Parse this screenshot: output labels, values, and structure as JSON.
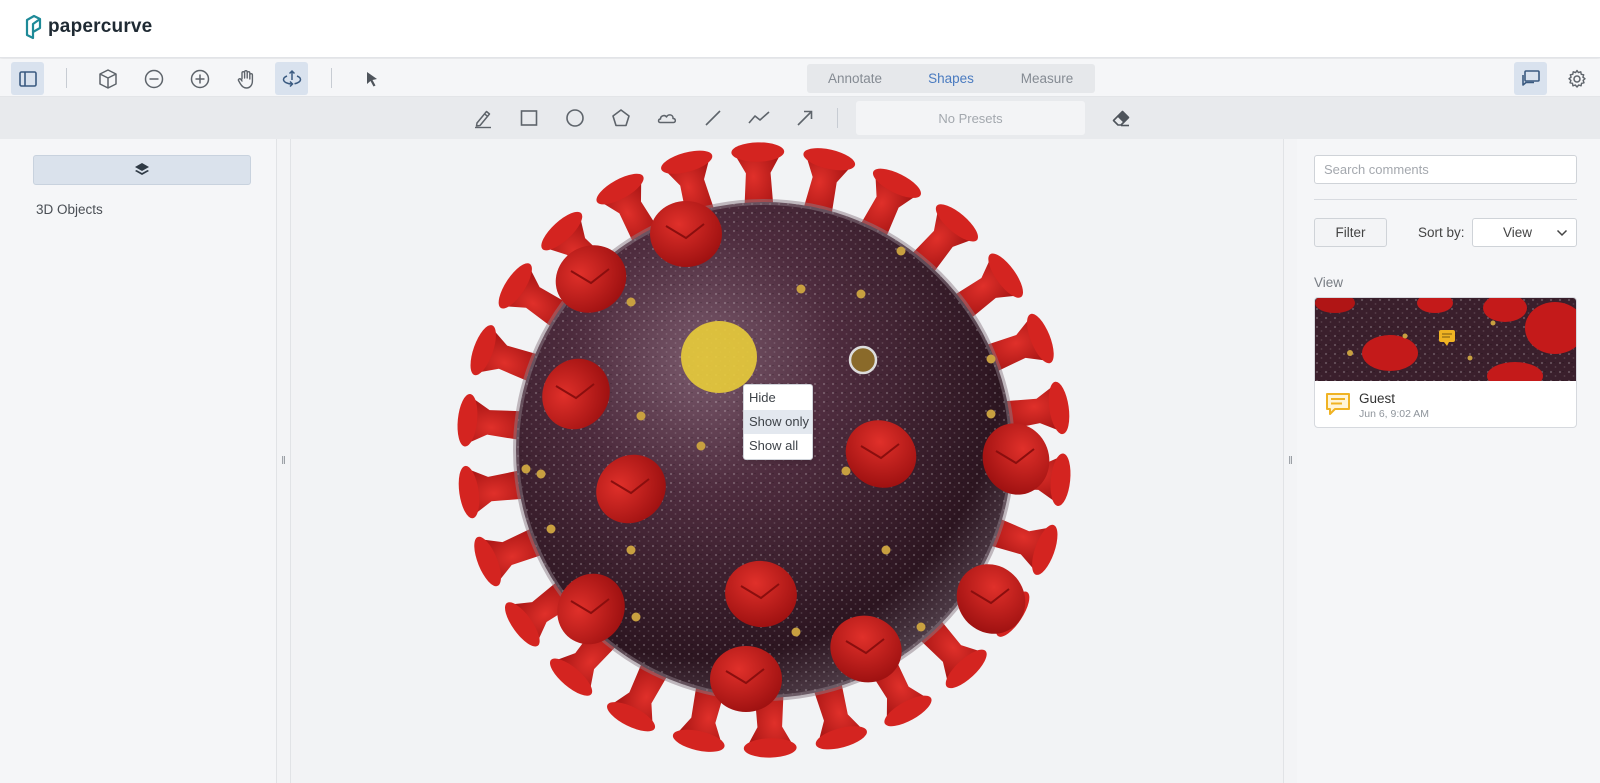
{
  "app": {
    "name": "papercurve"
  },
  "toolbar": {
    "modes": [
      {
        "label": "Annotate",
        "active": false
      },
      {
        "label": "Shapes",
        "active": true
      },
      {
        "label": "Measure",
        "active": false
      }
    ],
    "icons": [
      "sidebar-toggle-icon",
      "cube-icon",
      "zoom-out-icon",
      "zoom-in-icon",
      "pan-hand-icon",
      "orbit-icon",
      "pointer-icon"
    ],
    "active_tools": [
      "sidebar-toggle-icon",
      "orbit-icon"
    ]
  },
  "shapes_toolbar": {
    "icons": [
      "pen-icon",
      "rectangle-icon",
      "circle-icon",
      "polygon-icon",
      "cloud-icon",
      "line-icon",
      "polyline-icon",
      "arrow-icon",
      "eraser-icon"
    ],
    "presets_label": "No Presets"
  },
  "left_panel": {
    "layers_icon": "layers-icon",
    "section_label": "3D Objects"
  },
  "context_menu": {
    "items": [
      "Hide",
      "Show only",
      "Show all"
    ],
    "hovered": "Show only"
  },
  "right_panel": {
    "search_placeholder": "Search comments",
    "filter_label": "Filter",
    "sort_label": "Sort by:",
    "sort_value": "View",
    "group_label": "View",
    "comments": [
      {
        "author": "Guest",
        "date": "Jun 6, 9:02 AM"
      }
    ]
  },
  "colors": {
    "accent": "#4a7bc0",
    "spike": "#c41a1a",
    "body": "#4b2a3a",
    "highlight": "#e6c43a",
    "comment_icon": "#f0b323"
  }
}
